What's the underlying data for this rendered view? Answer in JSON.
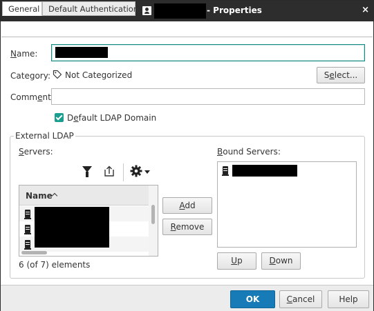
{
  "window": {
    "title_suffix": "- Properties",
    "close_glyph": "×",
    "icons": [
      "user-icon",
      "close-icon"
    ]
  },
  "tabs": [
    {
      "label": "General",
      "active": true
    },
    {
      "label": "Default Authentication",
      "active": false
    }
  ],
  "form": {
    "name_label_pre": "",
    "name_label_u": "N",
    "name_label_post": "ame:",
    "category_label": "Category:",
    "category_value": "Not Categorized",
    "select_btn_pre": "S",
    "select_btn_u": "e",
    "select_btn_post": "lect...",
    "comment_label_pre": "Comm",
    "comment_label_u": "e",
    "comment_label_post": "nt:",
    "comment_value": "",
    "default_ldap_pre": "D",
    "default_ldap_u": "e",
    "default_ldap_post": "fault LDAP Domain",
    "default_ldap_checked": true
  },
  "external_ldap": {
    "legend": "External LDAP",
    "servers_label_u": "S",
    "servers_label_post": "ervers:",
    "bound_label_u": "B",
    "bound_label_post": "ound Servers:",
    "table_header": "Name",
    "sort": "ascending",
    "element_count": "6 (of 7) elements",
    "add_u": "A",
    "add_post": "dd",
    "remove_u": "R",
    "remove_post": "emove",
    "up_u": "U",
    "up_post": "p",
    "down_u": "D",
    "down_post": "own",
    "toolbar_icons": [
      "filter-icon",
      "export-icon",
      "gear-icon"
    ]
  },
  "footer": {
    "ok": "OK",
    "cancel_u": "C",
    "cancel_post": "ancel",
    "help": "Help"
  },
  "colors": {
    "titlebar": "#2d2d2d",
    "accent": "#1a9e8f",
    "primary_button": "#167bb6",
    "redaction": "#000000"
  }
}
